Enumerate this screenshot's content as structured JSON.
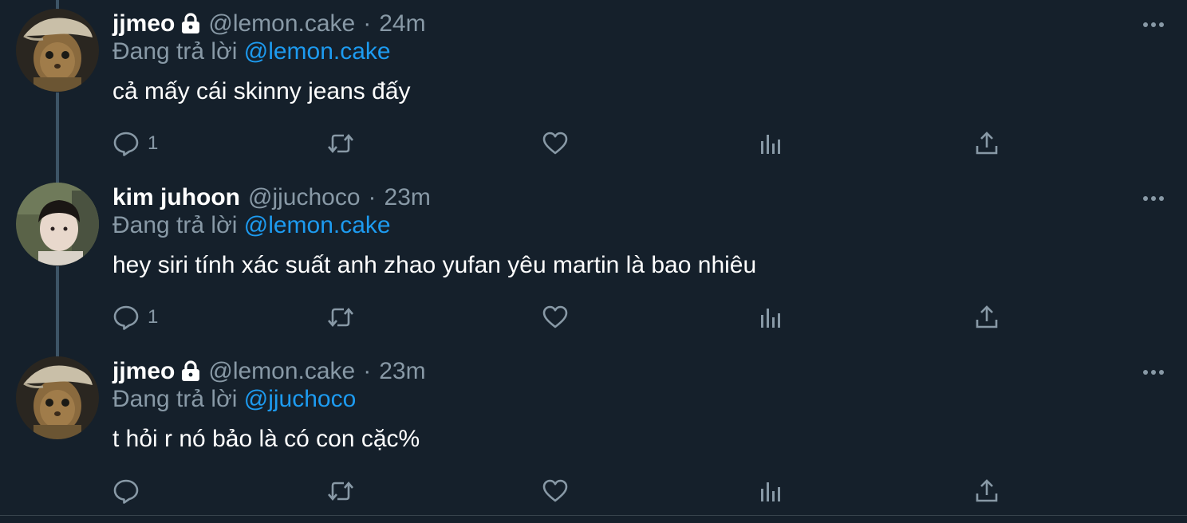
{
  "colors": {
    "background": "#15202b",
    "text": "#ffffff",
    "muted": "#8899a6",
    "link": "#1d9bf0",
    "thread_line": "#3d5466"
  },
  "tweets": [
    {
      "display_name": "jjmeo",
      "protected": true,
      "handle": "@lemon.cake",
      "separator": "·",
      "time": "24m",
      "reply_prefix": "Đang trả lời",
      "reply_to": "@lemon.cake",
      "text": "cả mấy cái skinny jeans đấy",
      "reply_count": "1",
      "avatar_icon": "cat-avatar"
    },
    {
      "display_name": "kim juhoon",
      "protected": false,
      "handle": "@jjuchoco",
      "separator": "·",
      "time": "23m",
      "reply_prefix": "Đang trả lời",
      "reply_to": "@lemon.cake",
      "text": "hey siri tính xác suất anh zhao yufan yêu martin là bao nhiêu",
      "reply_count": "1",
      "avatar_icon": "person-avatar"
    },
    {
      "display_name": "jjmeo",
      "protected": true,
      "handle": "@lemon.cake",
      "separator": "·",
      "time": "23m",
      "reply_prefix": "Đang trả lời",
      "reply_to": "@jjuchoco",
      "text": "t hỏi r nó bảo là có con cặc%",
      "reply_count": "",
      "avatar_icon": "cat-avatar"
    }
  ]
}
